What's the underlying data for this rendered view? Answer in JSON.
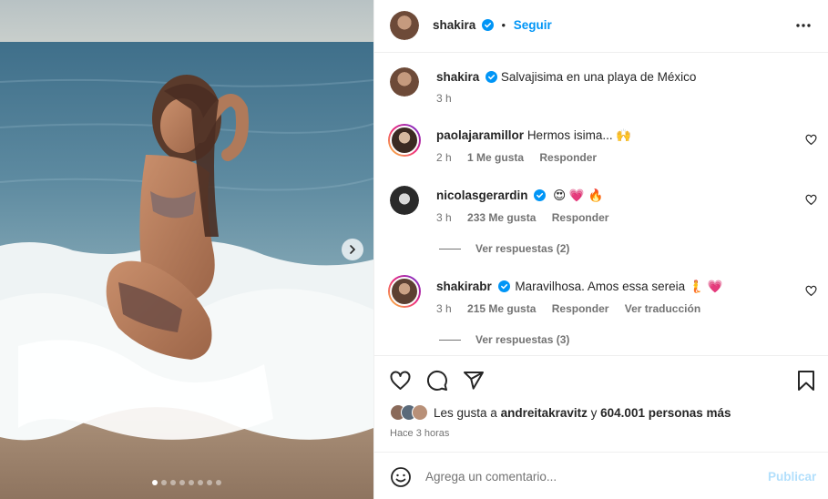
{
  "post": {
    "carousel_slide_count": 8,
    "carousel_active_index": 0
  },
  "header": {
    "username": "shakira",
    "separator": "•",
    "follow_label": "Seguir"
  },
  "caption": {
    "username": "shakira",
    "text": "Salvajisima en una playa de México",
    "time": "3 h"
  },
  "comments": [
    {
      "username": "paolajaramillor",
      "text": "Hermos isima... 🙌",
      "time": "2 h",
      "likes": "1 Me gusta",
      "reply": "Responder"
    },
    {
      "username": "nicolasgerardin",
      "text": "😍 💗 🔥",
      "time": "3 h",
      "likes": "233 Me gusta",
      "reply": "Responder",
      "view_replies": "Ver respuestas (2)"
    },
    {
      "username": "shakirabr",
      "text": "Maravilhosa. Amos essa sereia 🧜 💗",
      "time": "3 h",
      "likes": "215 Me gusta",
      "reply": "Responder",
      "translate": "Ver traducción",
      "view_replies": "Ver respuestas (3)"
    }
  ],
  "likes": {
    "prefix": "Les gusta a",
    "user": "andreitakravitz",
    "conj": "y",
    "others": "604.001 personas más"
  },
  "timestamp": "Hace 3 horas",
  "add_comment": {
    "placeholder": "Agrega un comentario...",
    "publish_label": "Publicar"
  },
  "colors": {
    "accent": "#0095f6",
    "publish_disabled": "#b2dffc",
    "verified": "#0095f6",
    "muted": "#737373"
  },
  "icons": [
    "more-options-icon",
    "heart-icon",
    "comment-icon",
    "share-icon",
    "bookmark-icon",
    "emoji-icon",
    "verified-icon",
    "chevron-right-icon"
  ]
}
